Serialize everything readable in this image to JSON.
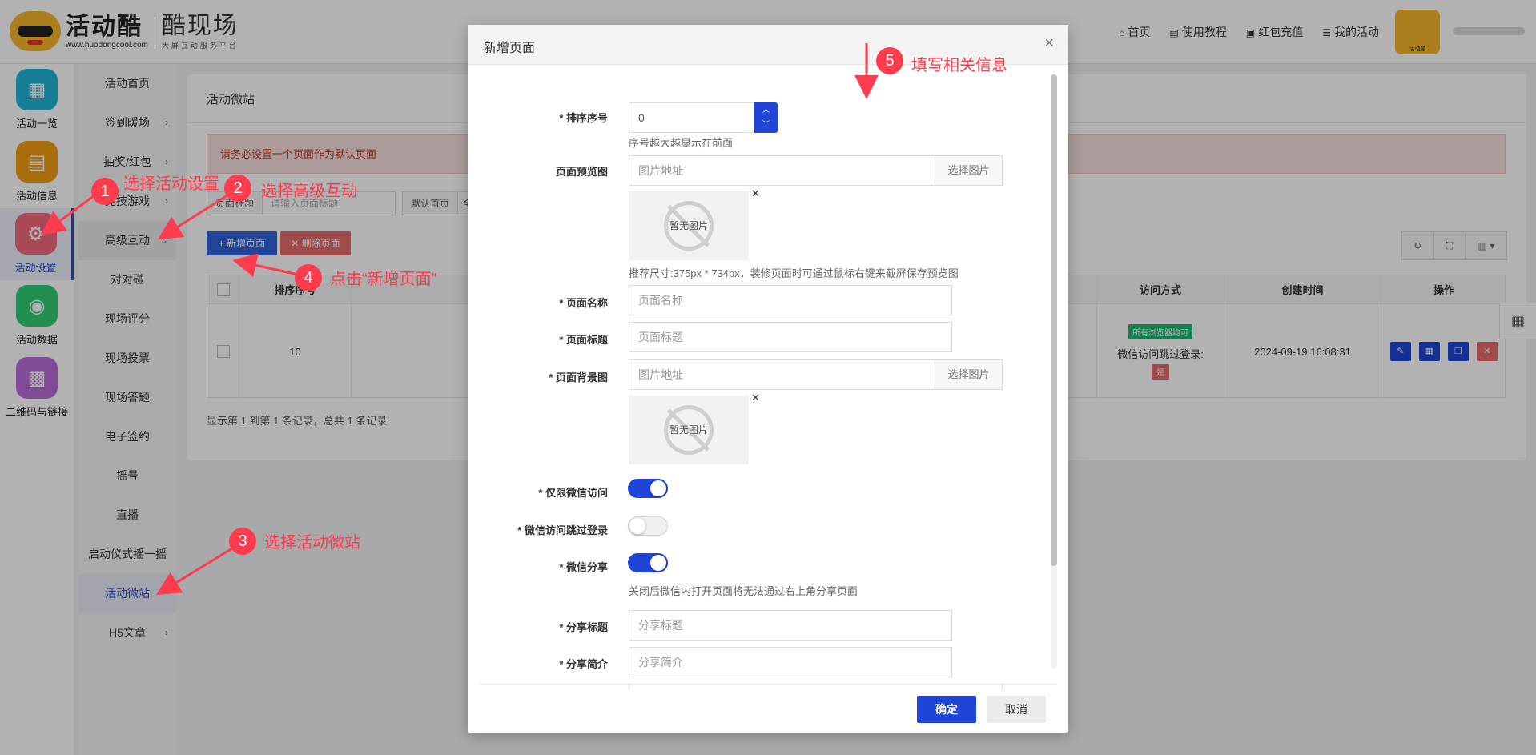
{
  "header": {
    "logo_main": "活动酷",
    "logo_url": "www.huodongcool.com",
    "logo_sub": "酷现场",
    "logo_sub_small": "大屏互动服务平台",
    "nav": [
      {
        "icon": "home-icon",
        "label": "首页"
      },
      {
        "icon": "doc-icon",
        "label": "使用教程"
      },
      {
        "icon": "redpacket-icon",
        "label": "红包充值"
      },
      {
        "icon": "list-icon",
        "label": "我的活动"
      }
    ],
    "avatar_label": "活动酷"
  },
  "iconbar": [
    {
      "label": "活动一览",
      "color": "#22b5d8",
      "glyph": "▦"
    },
    {
      "label": "活动信息",
      "color": "#f39c12",
      "glyph": "▤"
    },
    {
      "label": "活动设置",
      "color": "#f06b7c",
      "glyph": "⚙"
    },
    {
      "label": "活动数据",
      "color": "#2ecc71",
      "glyph": "◉"
    },
    {
      "label": "二维码与链接",
      "color": "#b86ad8",
      "glyph": "▩"
    }
  ],
  "subbar": [
    {
      "label": "活动首页",
      "chev": ""
    },
    {
      "label": "签到暖场",
      "chev": "›"
    },
    {
      "label": "抽奖/红包",
      "chev": "›"
    },
    {
      "label": "竞技游戏",
      "chev": "›"
    },
    {
      "label": "高级互动",
      "chev": "⌄"
    },
    {
      "label": "对对碰",
      "chev": ""
    },
    {
      "label": "现场评分",
      "chev": ""
    },
    {
      "label": "现场投票",
      "chev": ""
    },
    {
      "label": "现场答题",
      "chev": ""
    },
    {
      "label": "电子签约",
      "chev": ""
    },
    {
      "label": "摇号",
      "chev": ""
    },
    {
      "label": "直播",
      "chev": ""
    },
    {
      "label": "启动仪式摇一摇",
      "chev": ""
    },
    {
      "label": "活动微站",
      "chev": ""
    },
    {
      "label": "H5文章",
      "chev": "›"
    }
  ],
  "panel": {
    "title": "活动微站",
    "alert": "请务必设置一个页面作为默认页面",
    "search_label": "页面标题",
    "search_placeholder": "请输入页面标题",
    "default_label": "默认首页",
    "default_value": "全",
    "add_btn": "+ 新增页面",
    "del_btn": "✕ 删除页面",
    "tools": [
      "↻",
      "⛶",
      "▥ ▾"
    ],
    "columns": [
      "排序序号",
      "访问方式",
      "创建时间",
      "操作"
    ],
    "rows": [
      {
        "order": "10",
        "access_badge": "所有浏览器均可",
        "skip_login_label": "微信访问跳过登录:",
        "skip_login_value": "是",
        "created": "2024-09-19 16:08:31"
      }
    ],
    "summary": "显示第 1 到第 1 条记录，总共 1 条记录"
  },
  "modal": {
    "title": "新增页面",
    "close": "×",
    "fields": {
      "order_label": "* 排序序号",
      "order_value": "0",
      "order_hint": "序号越大越显示在前面",
      "preview_label": "页面预览图",
      "preview_placeholder": "图片地址",
      "choose_image": "选择图片",
      "no_image": "暂无图片",
      "preview_hint": "推荐尺寸:375px * 734px，装修页面时可通过鼠标右键来截屏保存预览图",
      "name_label": "* 页面名称",
      "name_placeholder": "页面名称",
      "title_label": "* 页面标题",
      "title_placeholder": "页面标题",
      "bg_label": "* 页面背景图",
      "bg_placeholder": "图片地址",
      "wechat_only_label": "* 仅限微信访问",
      "skip_login_label": "* 微信访问跳过登录",
      "share_label": "* 微信分享",
      "share_hint": "关闭后微信内打开页面将无法通过右上角分享页面",
      "share_title_label": "* 分享标题",
      "share_title_placeholder": "分享标题",
      "share_desc_label": "* 分享简介",
      "share_desc_placeholder": "分享简介"
    },
    "ok": "确定",
    "cancel": "取消"
  },
  "annotations": [
    {
      "num": "1",
      "text": "选择活动设置"
    },
    {
      "num": "2",
      "text": "选择高级互动"
    },
    {
      "num": "3",
      "text": "选择活动微站"
    },
    {
      "num": "4",
      "text": "点击“新增页面”"
    },
    {
      "num": "5",
      "text": "填写相关信息"
    }
  ],
  "colors": {
    "primary": "#1e45d8",
    "annotation": "#ff3b4e",
    "danger": "#e66b6b",
    "success": "#22b573"
  }
}
